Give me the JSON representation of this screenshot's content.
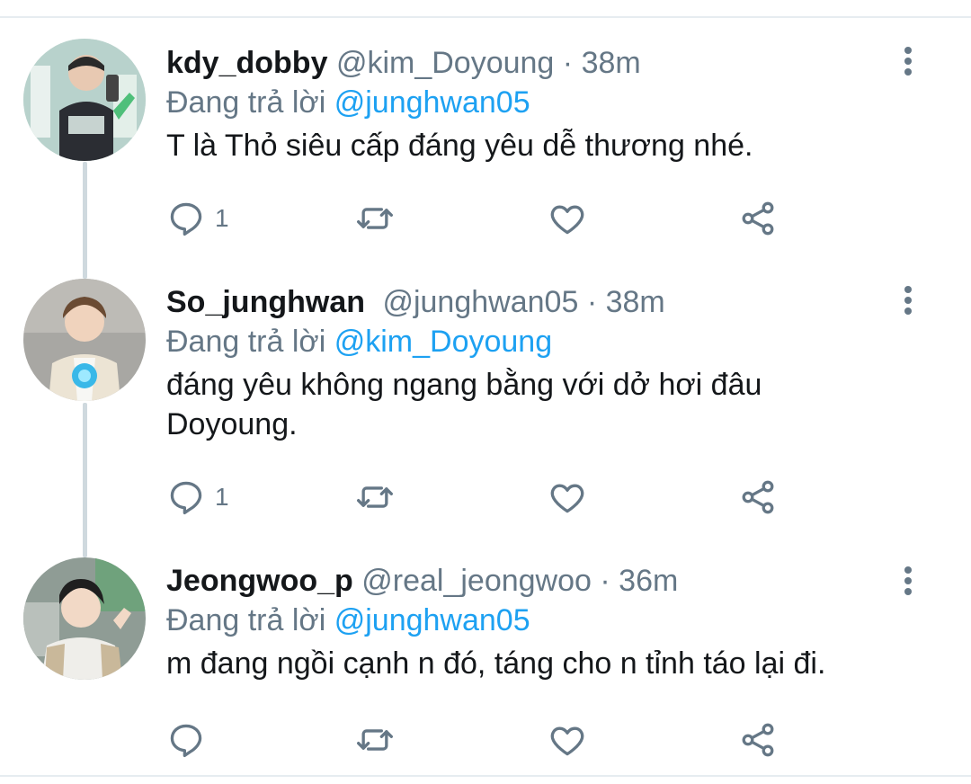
{
  "tweets": [
    {
      "name": "kdy_dobby",
      "handle": "@kim_Doyoung",
      "sep": "·",
      "time": "38m",
      "reply_prefix": "Đang trả lời",
      "reply_to": "@junghwan05",
      "text": "T là Thỏ siêu cấp đáng yêu dễ thương nhé.",
      "reply_count": "1"
    },
    {
      "name": "So_junghwan",
      "handle": "@junghwan05",
      "sep": "·",
      "time": "38m",
      "reply_prefix": "Đang trả lời",
      "reply_to": "@kim_Doyoung",
      "text": "đáng yêu không ngang bằng với dở hơi đâu Doyoung.",
      "reply_count": "1"
    },
    {
      "name": "Jeongwoo_p",
      "handle": "@real_jeongwoo",
      "sep": "·",
      "time": "36m",
      "reply_prefix": "Đang trả lời",
      "reply_to": "@junghwan05",
      "text": "m đang ngồi cạnh n đó, táng cho n tỉnh táo lại đi.",
      "reply_count": ""
    }
  ],
  "icons": {
    "reply": "reply-icon",
    "retweet": "retweet-icon",
    "like": "heart-icon",
    "share": "share-icon",
    "more": "more-vertical-icon"
  },
  "colors": {
    "link": "#1da1f2",
    "secondary": "#657786",
    "thread_line": "#cfd9de"
  }
}
